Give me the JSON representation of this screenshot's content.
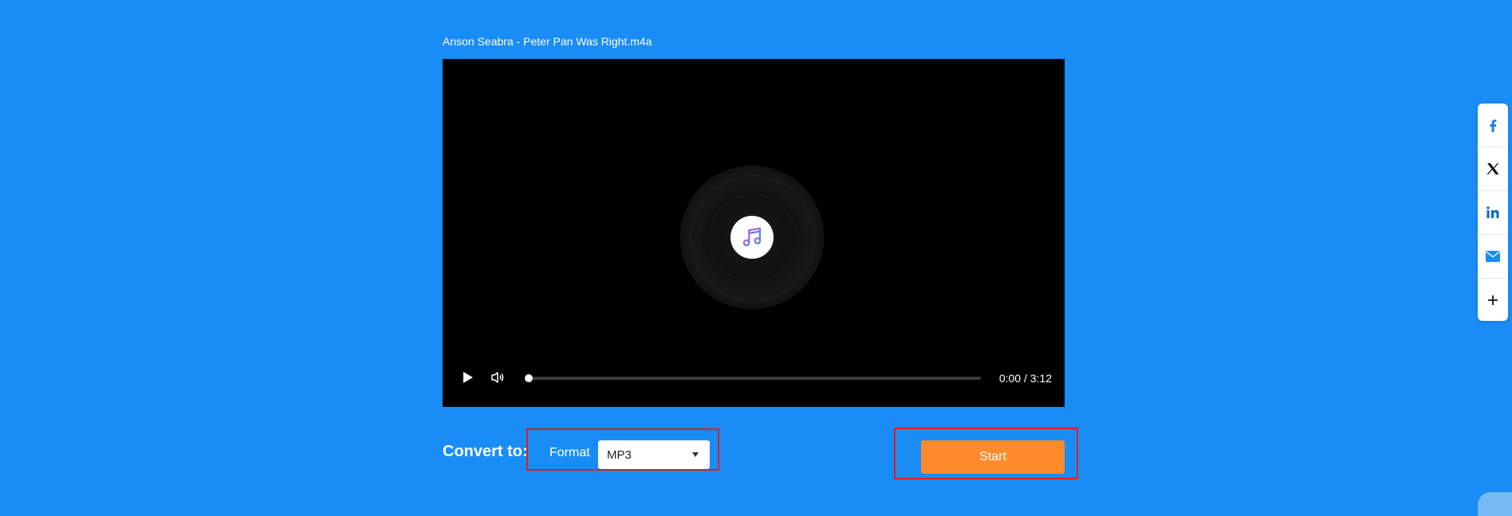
{
  "file": {
    "name": "Anson Seabra - Peter Pan Was Right.m4a"
  },
  "player": {
    "time_display": "0:00 / 3:12",
    "progress": 0
  },
  "convert": {
    "label": "Convert to:",
    "format_label": "Format",
    "format_value": "MP3",
    "start_label": "Start"
  },
  "share": [
    "facebook-icon",
    "x-icon",
    "linkedin-icon",
    "email-icon",
    "plus-icon"
  ],
  "colors": {
    "background": "#1a8cf5",
    "player": "#000000",
    "start_button": "#ff8a2b",
    "highlight": "#e02020"
  }
}
